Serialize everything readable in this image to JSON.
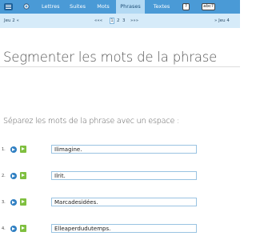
{
  "topnav": {
    "tabs": [
      {
        "label": "Lettres"
      },
      {
        "label": "Suites"
      },
      {
        "label": "Mots"
      },
      {
        "label": "Phrases"
      },
      {
        "label": "Textes"
      }
    ],
    "active_tab": "Phrases",
    "help_label": "?",
    "spell_label": "abc?"
  },
  "subnav": {
    "prev": "Jeu 2 «",
    "first": "«««",
    "current_page": "1",
    "page2": "2",
    "page3": "3",
    "last": "»»»",
    "next": "» Jeu 4"
  },
  "page_title": "Segmenter les mots de la phrase",
  "instruction": "Séparez les mots de la phrase avec un espace :",
  "exercises": [
    {
      "num": "1.",
      "value": "Ilimagine."
    },
    {
      "num": "2.",
      "value": "Ilrit."
    },
    {
      "num": "3.",
      "value": "Marcadesidées."
    },
    {
      "num": "4.",
      "value": "Elleaperdudutemps."
    }
  ],
  "colors": {
    "nav_bar": "#4a9ad6",
    "active_tab": "#b3d9f3",
    "sub_bar": "#d6ebf9",
    "sound_button": "#2f7fc2",
    "check_button": "#7fbf3f"
  },
  "icons": [
    "menu-icon",
    "settings-icon",
    "speaker-icon",
    "play-icon"
  ]
}
